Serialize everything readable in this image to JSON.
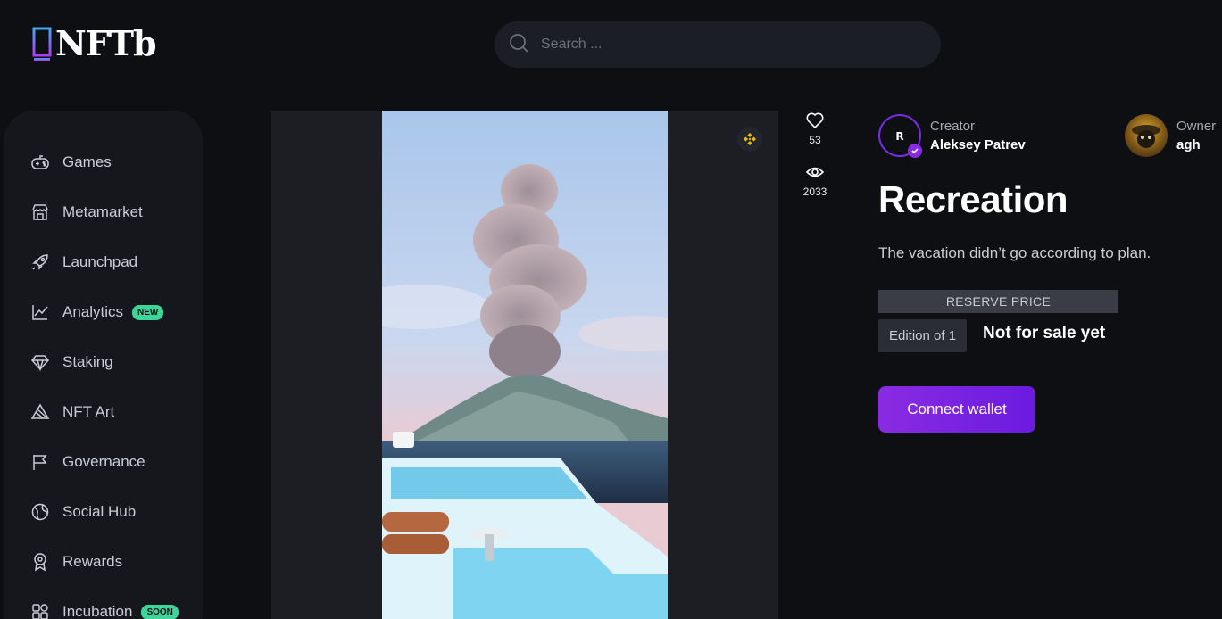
{
  "brand": {
    "logo_text": "NFTb"
  },
  "search": {
    "placeholder": "Search ..."
  },
  "sidebar": {
    "items": [
      {
        "label": "Games",
        "icon": "gamepad-icon"
      },
      {
        "label": "Metamarket",
        "icon": "store-icon"
      },
      {
        "label": "Launchpad",
        "icon": "rocket-icon"
      },
      {
        "label": "Analytics",
        "icon": "chart-icon",
        "badge": "NEW"
      },
      {
        "label": "Staking",
        "icon": "diamond-icon"
      },
      {
        "label": "NFT Art",
        "icon": "art-icon"
      },
      {
        "label": "Governance",
        "icon": "flag-icon"
      },
      {
        "label": "Social Hub",
        "icon": "globe-icon"
      },
      {
        "label": "Rewards",
        "icon": "award-icon"
      },
      {
        "label": "Incubation",
        "icon": "grid-icon",
        "badge": "SOON"
      }
    ]
  },
  "stats": {
    "likes": "53",
    "views": "2033"
  },
  "creator": {
    "role": "Creator",
    "name": "Aleksey Patrev"
  },
  "owner": {
    "role": "Owner",
    "name": "agh"
  },
  "item": {
    "title": "Recreation",
    "description": "The vacation didn’t go according to plan.",
    "reserve_label": "RESERVE PRICE",
    "edition": "Edition of 1",
    "sale_status": "Not for sale yet"
  },
  "actions": {
    "connect_label": "Connect wallet"
  },
  "colors": {
    "accent": "#8a2be2",
    "badge_green": "#3ed59a",
    "background": "#0d0f13"
  }
}
